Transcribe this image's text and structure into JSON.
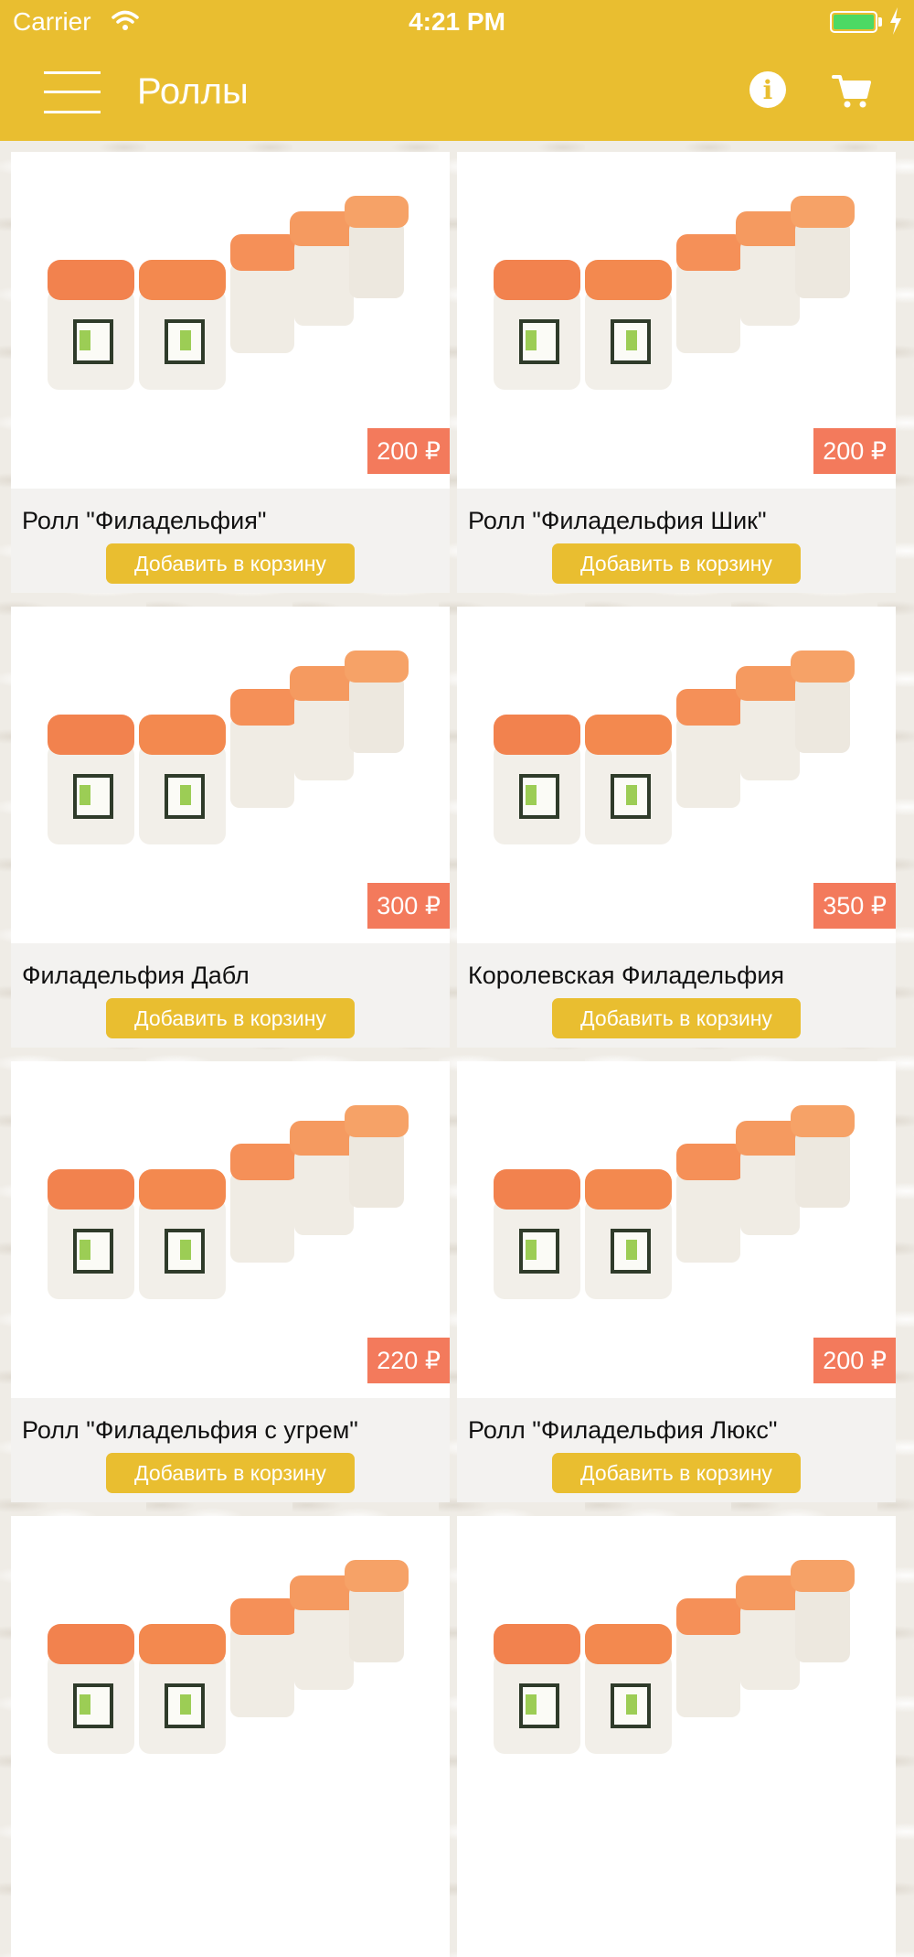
{
  "status_bar": {
    "carrier": "Carrier",
    "time": "4:21 PM",
    "battery_level": 1.0
  },
  "navbar": {
    "title": "Роллы",
    "menu_icon": "hamburger-icon",
    "info_icon": "info-icon",
    "cart_icon": "cart-icon"
  },
  "colors": {
    "brand": "#e9be30",
    "price_badge": "#f37a5c",
    "battery": "#4cd964"
  },
  "products": [
    {
      "name": "Ролл \"Филадельфия\"",
      "price": "200 ₽",
      "add_label": "Добавить в корзину"
    },
    {
      "name": "Ролл \"Филадельфия Шик\"",
      "price": "200 ₽",
      "add_label": "Добавить в корзину"
    },
    {
      "name": "Филадельфия Дабл",
      "price": "300 ₽",
      "add_label": "Добавить в корзину"
    },
    {
      "name": "Королевская Филадельфия",
      "price": "350 ₽",
      "add_label": "Добавить в корзину"
    },
    {
      "name": "Ролл \"Филадельфия с угрем\"",
      "price": "220 ₽",
      "add_label": "Добавить в корзину"
    },
    {
      "name": "Ролл \"Филадельфия Люкс\"",
      "price": "200 ₽",
      "add_label": "Добавить в корзину"
    }
  ]
}
